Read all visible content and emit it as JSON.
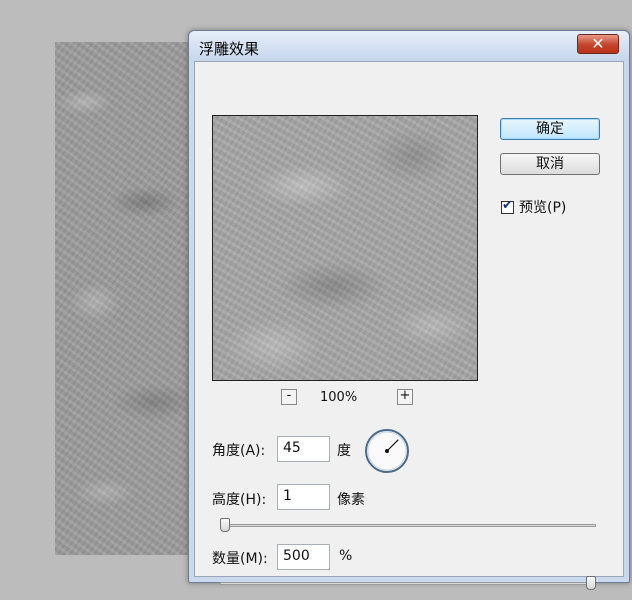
{
  "dialog": {
    "title": "浮雕效果",
    "close_glyph": "✕",
    "ok_label": "确定",
    "cancel_label": "取消",
    "preview_label": "预览(P)",
    "preview_checked": true,
    "zoom": {
      "minus": "-",
      "plus": "+",
      "level": "100%"
    },
    "angle": {
      "label": "角度(A):",
      "value": "45",
      "unit": "度",
      "degrees": 45
    },
    "height": {
      "label": "高度(H):",
      "value": "1",
      "unit": "像素",
      "slider_fraction": 0.0
    },
    "amount": {
      "label": "数量(M):",
      "value": "500",
      "unit": "%",
      "slider_fraction": 1.0
    }
  },
  "icons": {
    "close": "close-icon",
    "check": "checkmark-icon",
    "dial": "angle-dial-icon"
  },
  "colors": {
    "titlebar": "#c9d9ee",
    "close_button": "#c4432a",
    "default_button": "#bee6fd",
    "dialog_body": "#f0f0f0"
  }
}
